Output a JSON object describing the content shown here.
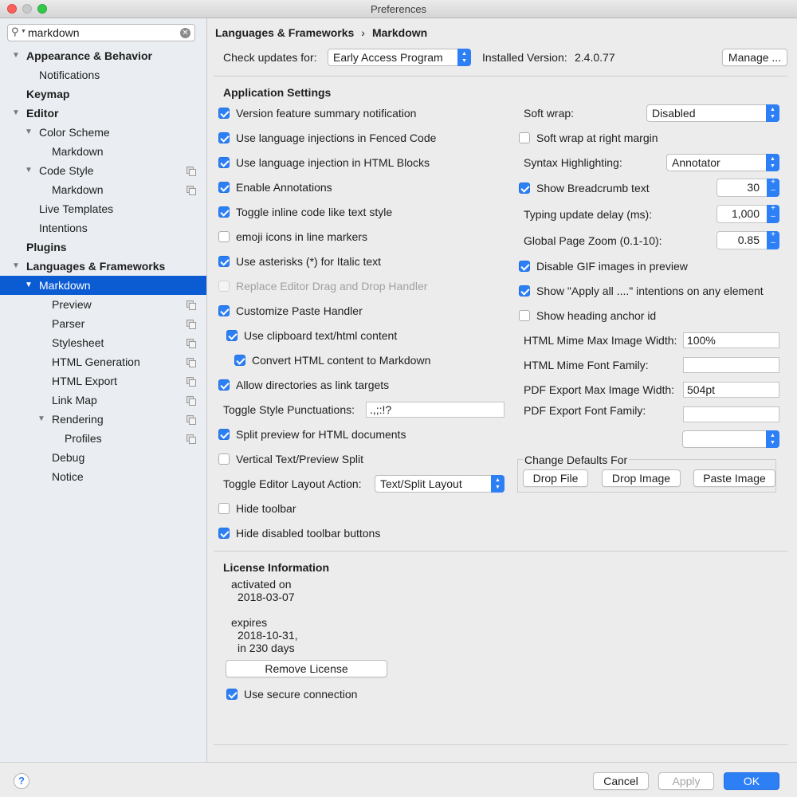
{
  "window": {
    "title": "Preferences"
  },
  "search": {
    "query": "markdown"
  },
  "sidebar": {
    "items": [
      {
        "label": "Appearance & Behavior"
      },
      {
        "label": "Notifications"
      },
      {
        "label": "Keymap"
      },
      {
        "label": "Editor"
      },
      {
        "label": "Color Scheme"
      },
      {
        "label": "Markdown"
      },
      {
        "label": "Code Style"
      },
      {
        "label": "Markdown"
      },
      {
        "label": "Live Templates"
      },
      {
        "label": "Intentions"
      },
      {
        "label": "Plugins"
      },
      {
        "label": "Languages & Frameworks"
      },
      {
        "label": "Markdown"
      },
      {
        "label": "Preview"
      },
      {
        "label": "Parser"
      },
      {
        "label": "Stylesheet"
      },
      {
        "label": "HTML Generation"
      },
      {
        "label": "HTML Export"
      },
      {
        "label": "Link Map"
      },
      {
        "label": "Rendering"
      },
      {
        "label": "Profiles"
      },
      {
        "label": "Debug"
      },
      {
        "label": "Notice"
      }
    ]
  },
  "breadcrumb": {
    "parent": "Languages & Frameworks",
    "separator": "›",
    "current": "Markdown"
  },
  "header": {
    "check_updates_label": "Check updates for:",
    "check_updates_value": "Early Access Program",
    "installed_version_label": "Installed Version:",
    "installed_version_value": "2.4.0.77",
    "manage_label": "Manage ..."
  },
  "app_settings": {
    "title": "Application Settings",
    "checks": [
      {
        "label": "Version feature summary notification"
      },
      {
        "label": "Use language injections in Fenced Code"
      },
      {
        "label": "Use language injection in HTML Blocks"
      },
      {
        "label": "Enable Annotations"
      },
      {
        "label": "Toggle inline code like text style"
      },
      {
        "label": "emoji icons in line markers"
      },
      {
        "label": "Use asterisks (*) for Italic text"
      },
      {
        "label": "Replace Editor Drag and Drop Handler"
      },
      {
        "label": "Customize Paste Handler"
      },
      {
        "label": "Use clipboard text/html content"
      },
      {
        "label": "Convert HTML content to Markdown"
      },
      {
        "label": "Allow directories as link targets"
      },
      {
        "label": "Split preview for HTML documents"
      },
      {
        "label": "Vertical Text/Preview Split"
      },
      {
        "label": "Hide toolbar"
      },
      {
        "label": "Hide disabled toolbar buttons"
      }
    ],
    "toggle_punct_label": "Toggle Style Punctuations:",
    "toggle_punct_value": ".,;:!?",
    "toggle_layout_label": "Toggle Editor Layout Action:",
    "toggle_layout_value": "Text/Split Layout"
  },
  "right": {
    "soft_wrap_label": "Soft wrap:",
    "soft_wrap_value": "Disabled",
    "soft_wrap_margin_label": "Soft wrap at right margin",
    "syntax_label": "Syntax Highlighting:",
    "syntax_value": "Annotator",
    "breadcrumb_label": "Show Breadcrumb text",
    "breadcrumb_value": "30",
    "typing_delay_label": "Typing update delay (ms):",
    "typing_delay_value": "1,000",
    "zoom_label": "Global Page Zoom (0.1-10):",
    "zoom_value": "0.85",
    "gif_label": "Disable GIF images in preview",
    "apply_all_label": "Show \"Apply all ....\" intentions on any element",
    "heading_anchor_label": "Show heading anchor id",
    "mime_width_label": "HTML Mime Max Image Width:",
    "mime_width_value": "100%",
    "mime_font_label": "HTML Mime Font Family:",
    "mime_font_value": "",
    "pdf_width_label": "PDF Export Max Image Width:",
    "pdf_width_value": "504pt",
    "pdf_font_label": "PDF Export Font Family:",
    "pdf_font_value": "",
    "defaults_title": "Change Defaults For",
    "drop_file": "Drop File",
    "drop_image": "Drop Image",
    "paste_image": "Paste Image"
  },
  "license": {
    "title": "License Information",
    "activated_label": "activated on",
    "activated_date": "2018-03-07",
    "expires_label": "expires",
    "expires_date": "2018-10-31,",
    "expires_days": "in 230 days",
    "remove_label": "Remove License",
    "secure_label": "Use secure connection"
  },
  "footer": {
    "help": "?",
    "cancel": "Cancel",
    "apply": "Apply",
    "ok": "OK"
  },
  "colors": {
    "accent": "#2d7ff6",
    "selection": "#0b5bd2"
  }
}
